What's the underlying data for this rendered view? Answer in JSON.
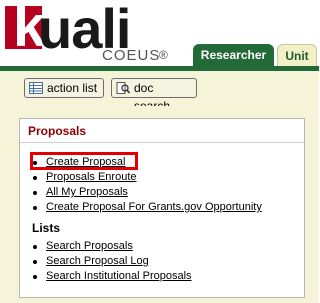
{
  "header": {
    "logo_letter": "k",
    "logo_word": "uali",
    "product": "COEUS",
    "reg_mark": "®",
    "tabs": [
      {
        "label": "Researcher",
        "active": true
      },
      {
        "label": "Unit",
        "active": false
      }
    ]
  },
  "toolbar": {
    "action_list_label": "action list",
    "doc_search_label": "doc search"
  },
  "panel": {
    "title": "Proposals",
    "links": [
      "Create Proposal",
      "Proposals Enroute",
      "All My Proposals",
      "Create Proposal For Grants.gov Opportunity"
    ],
    "lists_heading": "Lists",
    "list_links": [
      "Search Proposals",
      "Search Proposal Log",
      "Search Institutional Proposals"
    ]
  },
  "colors": {
    "brand_red": "#b5001f",
    "tab_green": "#226a37",
    "panel_bg": "#f5f4d9",
    "highlight": "#e00000"
  }
}
